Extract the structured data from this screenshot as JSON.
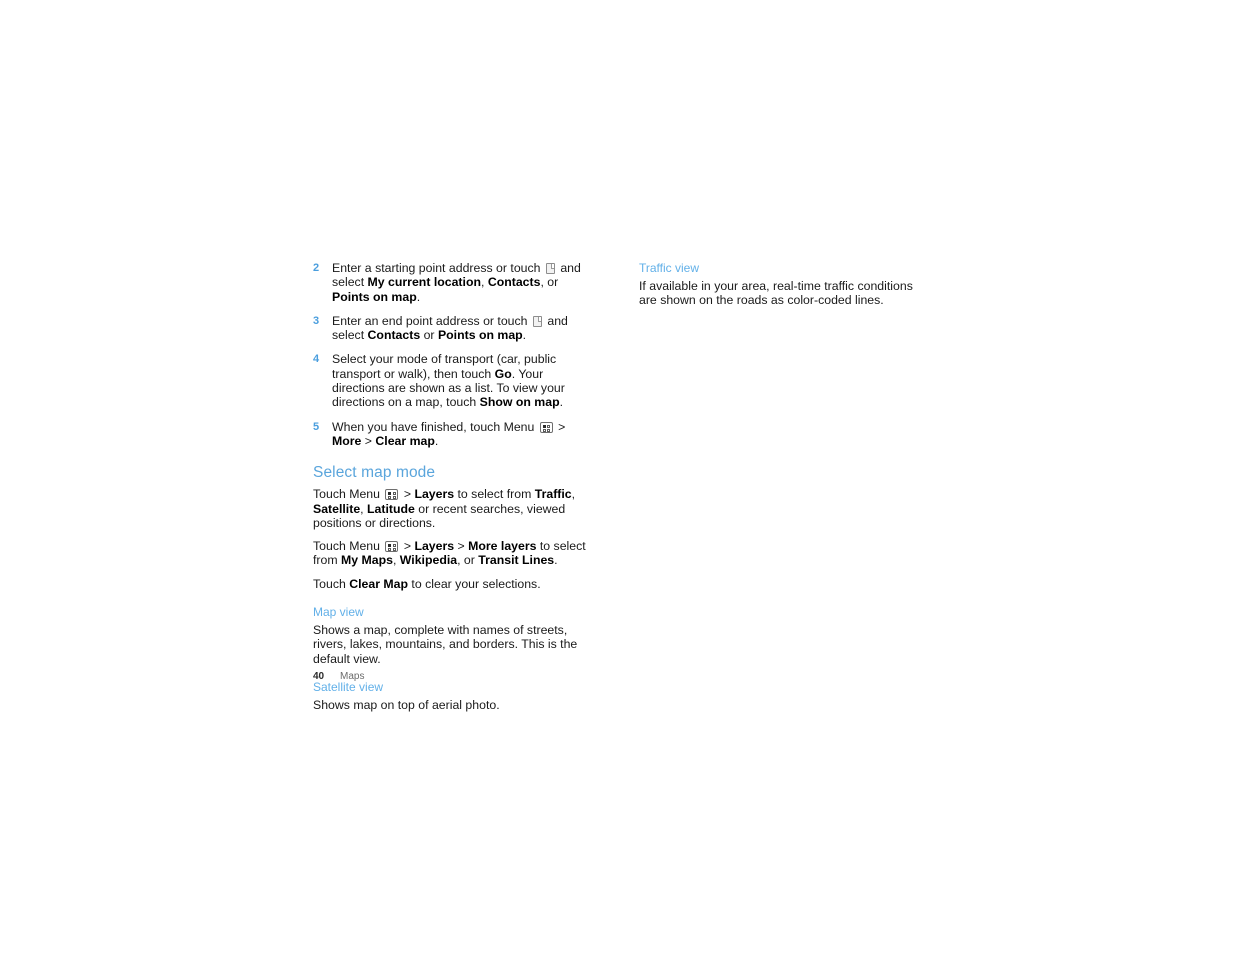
{
  "document": {
    "type": "user-guide-page",
    "chapter": "Maps",
    "page_number": "40"
  },
  "colors": {
    "heading_primary": "#5aa5dc",
    "heading_secondary": "#62b0e8",
    "step_number": "#4a9ede",
    "body_text": "#1a1a1a",
    "footer_chapter": "#6b6b6b",
    "background": "#ffffff"
  },
  "left_column": {
    "steps": [
      {
        "number": "2",
        "parts": [
          {
            "type": "text",
            "value": "Enter a starting point address or touch "
          },
          {
            "type": "icon",
            "value": "contacts-icon"
          },
          {
            "type": "text",
            "value": " and select "
          },
          {
            "type": "bold",
            "value": "My current location"
          },
          {
            "type": "text",
            "value": ", "
          },
          {
            "type": "bold",
            "value": "Contacts"
          },
          {
            "type": "text",
            "value": ", or "
          },
          {
            "type": "bold",
            "value": "Points on map"
          },
          {
            "type": "text",
            "value": "."
          }
        ]
      },
      {
        "number": "3",
        "parts": [
          {
            "type": "text",
            "value": "Enter an end point address or touch "
          },
          {
            "type": "icon",
            "value": "contacts-icon"
          },
          {
            "type": "text",
            "value": " and select "
          },
          {
            "type": "bold",
            "value": "Contacts"
          },
          {
            "type": "text",
            "value": " or "
          },
          {
            "type": "bold",
            "value": "Points on map"
          },
          {
            "type": "text",
            "value": "."
          }
        ]
      },
      {
        "number": "4",
        "parts": [
          {
            "type": "text",
            "value": "Select your mode of transport (car, public transport or walk), then touch "
          },
          {
            "type": "bold",
            "value": "Go"
          },
          {
            "type": "text",
            "value": ". Your directions are shown as a list. To view your directions on a map, touch "
          },
          {
            "type": "bold",
            "value": "Show on map"
          },
          {
            "type": "text",
            "value": "."
          }
        ]
      },
      {
        "number": "5",
        "parts": [
          {
            "type": "text",
            "value": "When you have finished, touch Menu "
          },
          {
            "type": "icon",
            "value": "menu-icon"
          },
          {
            "type": "text",
            "value": " > "
          },
          {
            "type": "bold",
            "value": "More"
          },
          {
            "type": "text",
            "value": " > "
          },
          {
            "type": "bold",
            "value": "Clear map"
          },
          {
            "type": "text",
            "value": "."
          }
        ]
      }
    ],
    "section": {
      "heading": "Select map mode",
      "paragraphs": [
        {
          "parts": [
            {
              "type": "text",
              "value": "Touch Menu "
            },
            {
              "type": "icon",
              "value": "menu-icon"
            },
            {
              "type": "text",
              "value": " > "
            },
            {
              "type": "bold",
              "value": "Layers"
            },
            {
              "type": "text",
              "value": " to select from "
            },
            {
              "type": "bold",
              "value": "Traffic"
            },
            {
              "type": "text",
              "value": ", "
            },
            {
              "type": "bold",
              "value": "Satellite"
            },
            {
              "type": "text",
              "value": ", "
            },
            {
              "type": "bold",
              "value": "Latitude"
            },
            {
              "type": "text",
              "value": " or recent searches, viewed positions or directions."
            }
          ]
        },
        {
          "parts": [
            {
              "type": "text",
              "value": "Touch Menu "
            },
            {
              "type": "icon",
              "value": "menu-icon"
            },
            {
              "type": "text",
              "value": " > "
            },
            {
              "type": "bold",
              "value": "Layers"
            },
            {
              "type": "text",
              "value": " > "
            },
            {
              "type": "bold",
              "value": "More layers"
            },
            {
              "type": "text",
              "value": " to select from "
            },
            {
              "type": "bold",
              "value": "My Maps"
            },
            {
              "type": "text",
              "value": ", "
            },
            {
              "type": "bold",
              "value": "Wikipedia"
            },
            {
              "type": "text",
              "value": ", or "
            },
            {
              "type": "bold",
              "value": "Transit Lines"
            },
            {
              "type": "text",
              "value": "."
            }
          ]
        },
        {
          "parts": [
            {
              "type": "text",
              "value": "Touch "
            },
            {
              "type": "bold",
              "value": "Clear Map"
            },
            {
              "type": "text",
              "value": " to clear your selections."
            }
          ]
        }
      ],
      "subsections": [
        {
          "heading": "Map view",
          "text": "Shows a map, complete with names of streets, rivers, lakes, mountains, and borders. This is the default view."
        },
        {
          "heading": "Satellite view",
          "text": "Shows map on top of aerial photo."
        }
      ]
    }
  },
  "right_column": {
    "subsections": [
      {
        "heading": "Traffic view",
        "text": "If available in your area, real-time traffic conditions are shown on the roads as color-coded lines."
      }
    ]
  },
  "footer": {
    "page_number": "40",
    "chapter": "Maps"
  }
}
